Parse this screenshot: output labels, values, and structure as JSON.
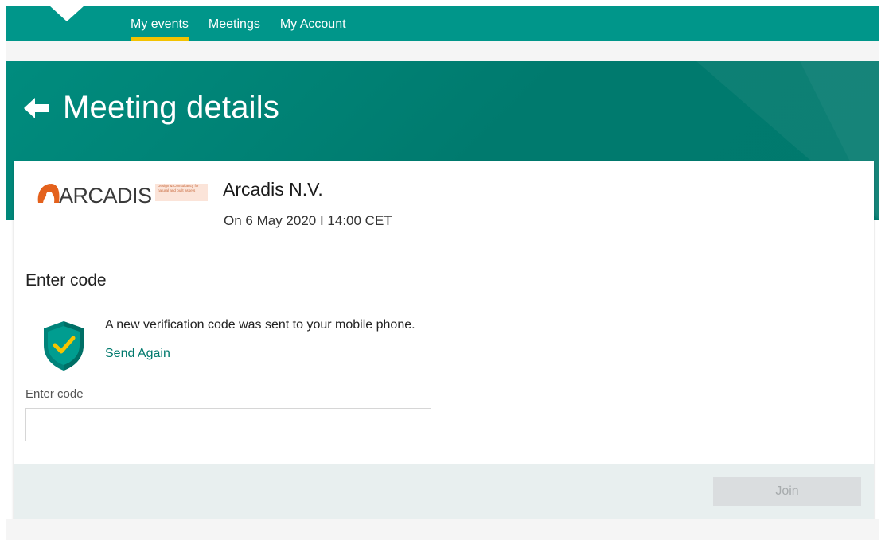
{
  "nav": {
    "items": [
      {
        "label": "My events",
        "active": true
      },
      {
        "label": "Meetings",
        "active": false
      },
      {
        "label": "My Account",
        "active": false
      }
    ],
    "accent_color": "#f3c200",
    "bg_color": "#00968a"
  },
  "hero": {
    "back_icon": "arrow-left-icon",
    "title": "Meeting details"
  },
  "meeting": {
    "logo": {
      "wordmark": "ARCADIS",
      "tagline": "Design & Consultancy for natural and built assets"
    },
    "company": "Arcadis N.V.",
    "date": "On 6 May 2020 I 14:00 CET"
  },
  "verification": {
    "section_title": "Enter code",
    "shield_icon": "shield-check-icon",
    "message": "A new verification code was sent to your mobile phone.",
    "send_again": "Send Again",
    "field_label": "Enter code",
    "field_value": "",
    "field_placeholder": ""
  },
  "footer": {
    "join_label": "Join",
    "join_enabled": false
  }
}
